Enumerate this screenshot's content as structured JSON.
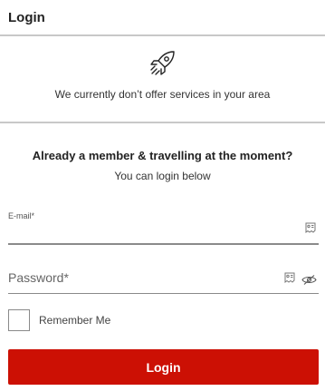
{
  "header": {
    "title": "Login"
  },
  "notice": {
    "icon": "rocket-icon",
    "text": "We currently don’t offer services in your area"
  },
  "intro": {
    "title": "Already a member & travelling at the moment?",
    "subtitle": "You can login below"
  },
  "form": {
    "email_label": "E-mail*",
    "email_value": "",
    "password_placeholder": "Password*",
    "password_value": "",
    "remember_label": "Remember Me",
    "remember_checked": false,
    "submit_label": "Login"
  },
  "colors": {
    "accent": "#cc1004",
    "divider": "#c8c8c8"
  }
}
